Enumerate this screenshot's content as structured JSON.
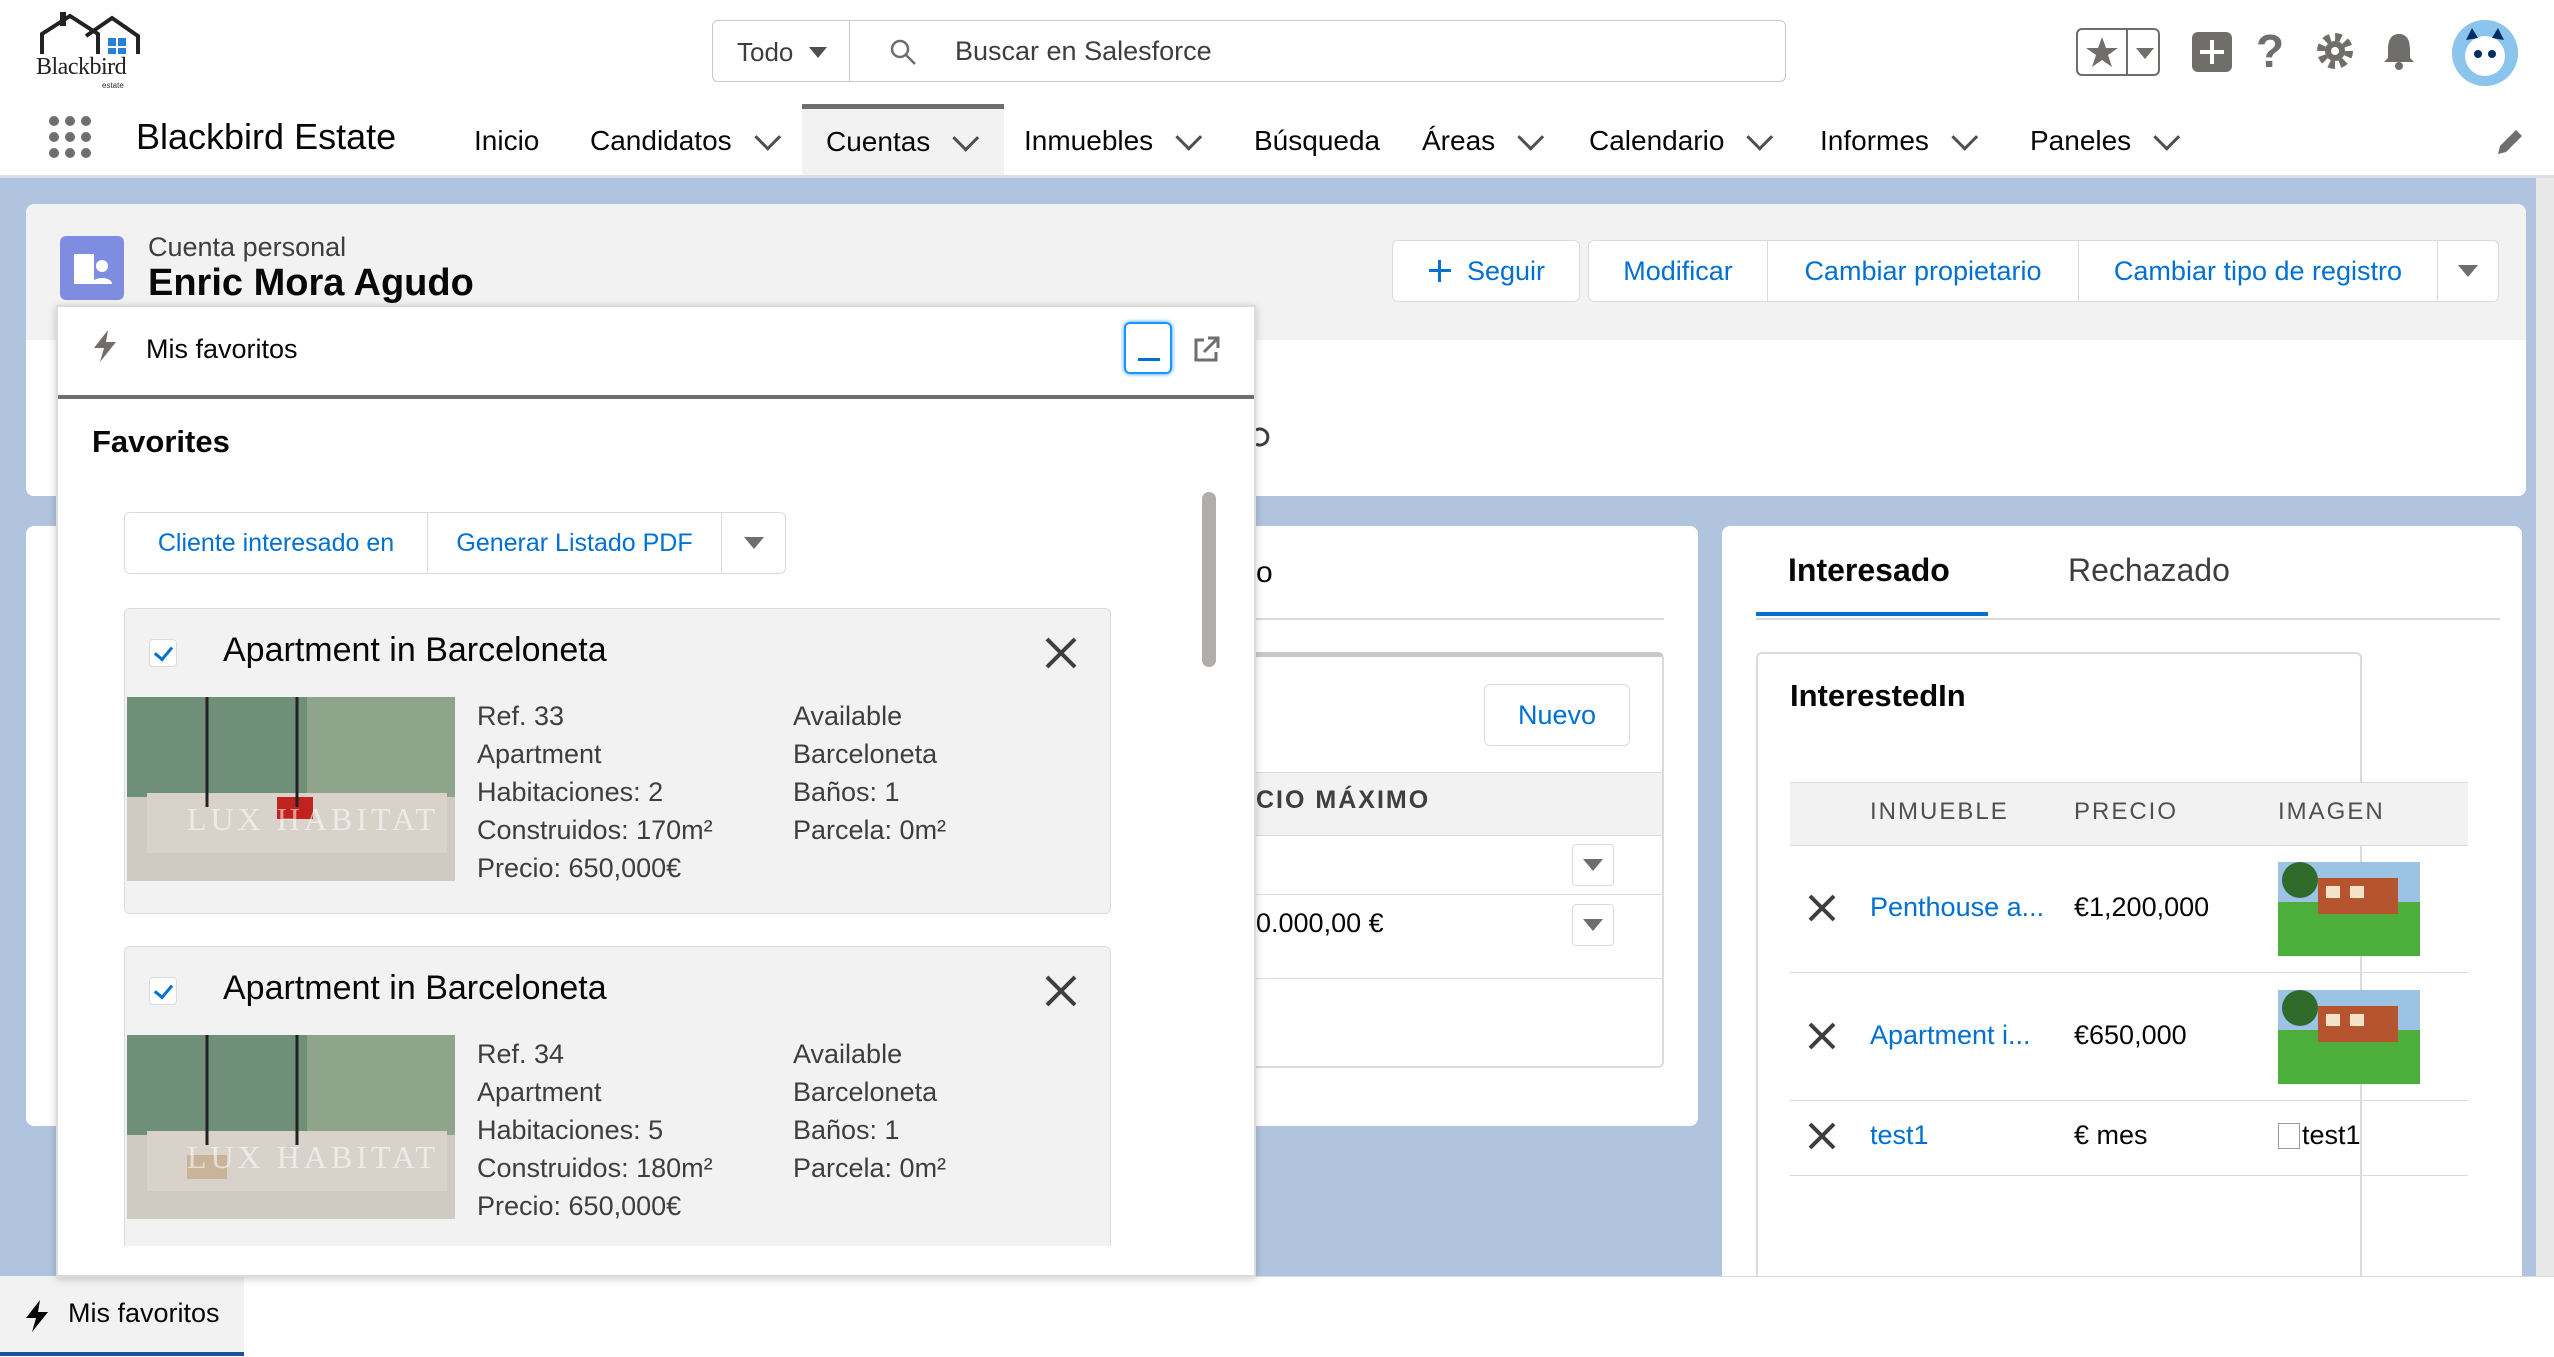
{
  "brand": {
    "logo_text": "Blackbird",
    "logo_sub": "estate"
  },
  "search": {
    "scope": "Todo",
    "placeholder": "Buscar en Salesforce"
  },
  "nav": {
    "app_name": "Blackbird Estate",
    "items": [
      {
        "label": "Inicio"
      },
      {
        "label": "Candidatos"
      },
      {
        "label": "Cuentas"
      },
      {
        "label": "Inmuebles"
      },
      {
        "label": "Búsqueda"
      },
      {
        "label": "Áreas"
      },
      {
        "label": "Calendario"
      },
      {
        "label": "Informes"
      },
      {
        "label": "Paneles"
      }
    ]
  },
  "record": {
    "type": "Cuenta personal",
    "name": "Enric Mora Agudo",
    "actions": [
      "Seguir",
      "Modificar",
      "Cambiar propietario",
      "Cambiar tipo de registro"
    ]
  },
  "middle": {
    "partial_tab": "o",
    "new_button": "Nuevo",
    "col_header": "CIO MÁXIMO",
    "row_value": "0.000,00 €"
  },
  "right": {
    "tabs": [
      "Interesado",
      "Rechazado"
    ],
    "section_title": "InterestedIn",
    "columns": [
      "INMUEBLE",
      "PRECIO",
      "IMAGEN"
    ],
    "rows": [
      {
        "name": "Penthouse a...",
        "price": "€1,200,000",
        "image": ""
      },
      {
        "name": "Apartment i...",
        "price": "€650,000",
        "image": ""
      },
      {
        "name": "test1",
        "price": "€ mes",
        "image": "test1"
      }
    ]
  },
  "popup": {
    "title": "Mis favoritos",
    "section_title": "Favorites",
    "buttons": [
      "Cliente interesado en",
      "Generar Listado PDF"
    ],
    "watermark": "LUX HABITAT",
    "properties": [
      {
        "title": "Apartment in Barceloneta",
        "ref": "Ref. 33",
        "type": "Apartment",
        "rooms": "Habitaciones: 2",
        "built": "Construidos: 170m²",
        "price": "Precio: 650,000€",
        "status": "Available",
        "city": "Barceloneta",
        "baths": "Baños: 1",
        "plot": "Parcela: 0m²"
      },
      {
        "title": "Apartment in Barceloneta",
        "ref": "Ref. 34",
        "type": "Apartment",
        "rooms": "Habitaciones: 5",
        "built": "Construidos: 180m²",
        "price": "Precio: 650,000€",
        "status": "Available",
        "city": "Barceloneta",
        "baths": "Baños: 1",
        "plot": "Parcela: 0m²"
      }
    ]
  },
  "utility": {
    "label": "Mis favoritos"
  },
  "colors": {
    "link": "#0070d2",
    "brand_bg": "#b0c4df",
    "account_icon": "#7f8de1"
  }
}
